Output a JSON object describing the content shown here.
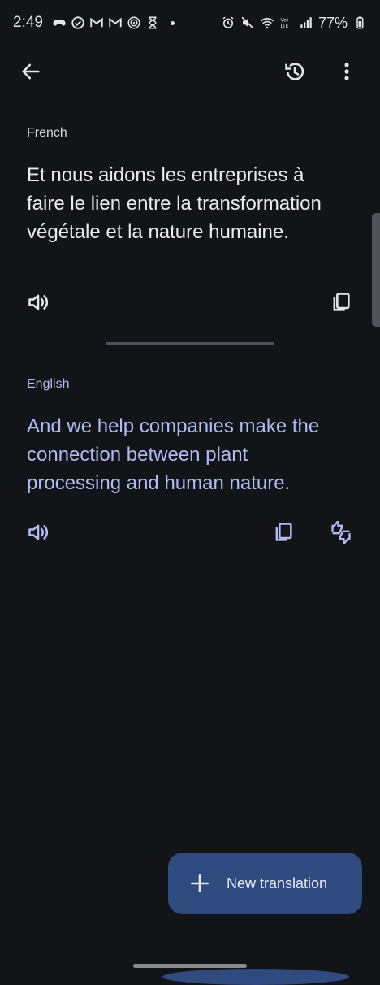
{
  "status_bar": {
    "time": "2:49",
    "battery": "77%"
  },
  "source": {
    "language": "French",
    "text": "Et nous aidons les entreprises à faire le lien entre la transformation végétale et la nature humaine."
  },
  "target": {
    "language": "English",
    "text": "And we help companies make the connection between plant processing and human nature."
  },
  "fab": {
    "label": "New translation"
  },
  "colors": {
    "background": "#131417",
    "accent_text": "#aebcf3",
    "fab_background": "#2e4a7f"
  }
}
